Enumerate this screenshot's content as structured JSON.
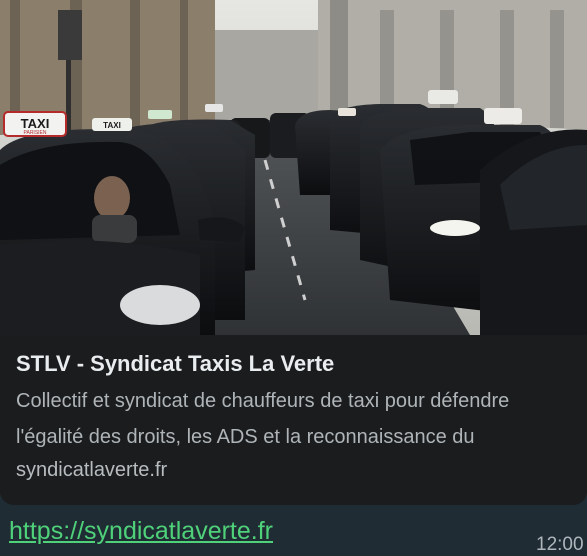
{
  "link_preview": {
    "title": "STLV - Syndicat Taxis La Verte",
    "description": "Collectif et syndicat de chauffeurs de taxi pour défendre l'égalité des droits, les ADS et la reconnaissance du",
    "domain": "syndicatlaverte.fr",
    "image_sign_text": "TAXI",
    "image_sign_subtext": "PARISIEN",
    "image_sign_text_2": "TAXI"
  },
  "message": {
    "link_text": "https://syndicatlaverte.fr",
    "time": "12:00"
  },
  "colors": {
    "link": "#4fd17a",
    "card_background": "#1b1c1d",
    "chat_background": "#1f2c34"
  }
}
